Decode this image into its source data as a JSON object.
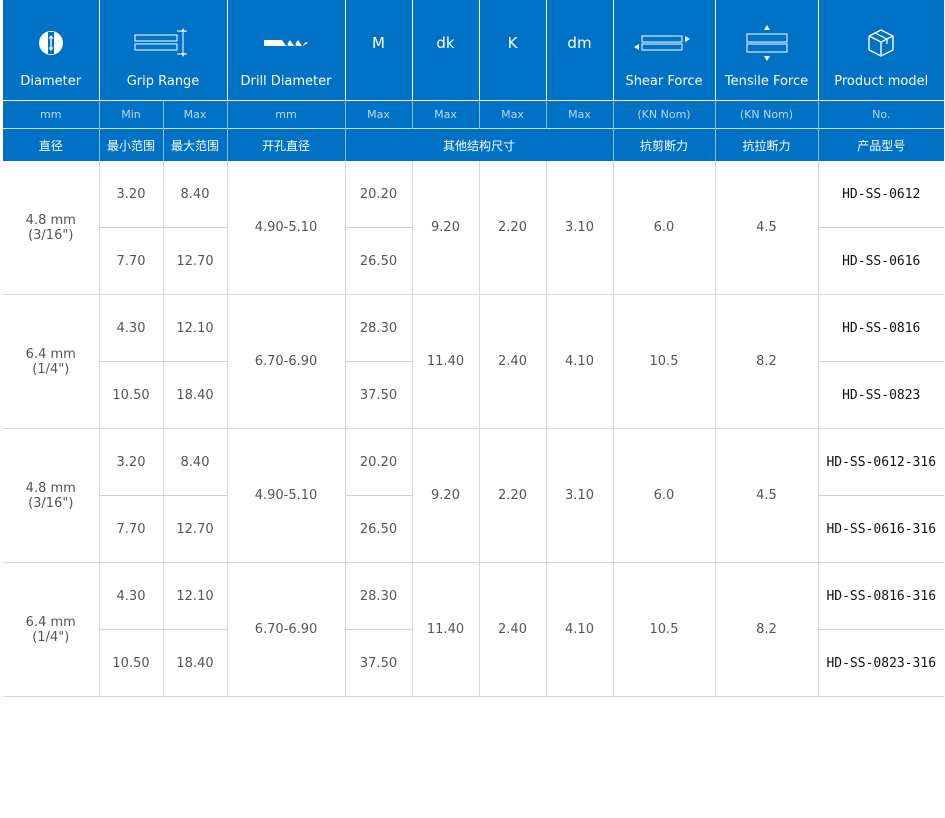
{
  "headers": {
    "diameter": {
      "title": "Diameter",
      "unit": "mm",
      "cn": "直径"
    },
    "grip": {
      "title": "Grip Range",
      "min": "Min",
      "max": "Max",
      "cn_min": "最小范围",
      "cn_max": "最大范围"
    },
    "drill": {
      "title": "Drill Diameter",
      "unit": "mm",
      "cn": "开孔直径"
    },
    "m": {
      "title": "M",
      "unit": "Max"
    },
    "dk": {
      "title": "dk",
      "unit": "Max"
    },
    "k": {
      "title": "K",
      "unit": "Max"
    },
    "dm": {
      "title": "dm",
      "unit": "Max"
    },
    "other_cn": "其他结构尺寸",
    "shear": {
      "title": "Shear Force",
      "unit": "(KN Nom)",
      "cn": "抗剪断力"
    },
    "tensile": {
      "title": "Tensile Force",
      "unit": "(KN Nom)",
      "cn": "抗拉断力"
    },
    "model": {
      "title": "Product model",
      "unit": "No.",
      "cn": "产品型号"
    }
  },
  "groups": [
    {
      "dia": "4.8 mm",
      "dia_in": "(3/16\")",
      "drill": "4.90-5.10",
      "dk": "9.20",
      "k": "2.20",
      "dm": "3.10",
      "shear": "6.0",
      "tensile": "4.5",
      "rows": [
        {
          "min": "3.20",
          "max": "8.40",
          "m": "20.20",
          "model_prefix": "HD-SS",
          "model_suffix": "-0612"
        },
        {
          "min": "7.70",
          "max": "12.70",
          "m": "26.50",
          "model_prefix": "HD-SS",
          "model_suffix": "-0616"
        }
      ]
    },
    {
      "dia": "6.4 mm",
      "dia_in": "(1/4\")",
      "drill": "6.70-6.90",
      "dk": "11.40",
      "k": "2.40",
      "dm": "4.10",
      "shear": "10.5",
      "tensile": "8.2",
      "rows": [
        {
          "min": "4.30",
          "max": "12.10",
          "m": "28.30",
          "model_prefix": "HD-SS",
          "model_suffix": "-0816"
        },
        {
          "min": "10.50",
          "max": "18.40",
          "m": "37.50",
          "model_prefix": "HD-SS",
          "model_suffix": "-0823"
        }
      ]
    },
    {
      "dia": "4.8 mm",
      "dia_in": "(3/16\")",
      "drill": "4.90-5.10",
      "dk": "9.20",
      "k": "2.20",
      "dm": "3.10",
      "shear": "6.0",
      "tensile": "4.5",
      "rows": [
        {
          "min": "3.20",
          "max": "8.40",
          "m": "20.20",
          "model_prefix": "HD-SS",
          "model_suffix": "-0612-316"
        },
        {
          "min": "7.70",
          "max": "12.70",
          "m": "26.50",
          "model_prefix": "HD-SS",
          "model_suffix": "-0616-316"
        }
      ]
    },
    {
      "dia": "6.4 mm",
      "dia_in": "(1/4\")",
      "drill": "6.70-6.90",
      "dk": "11.40",
      "k": "2.40",
      "dm": "4.10",
      "shear": "10.5",
      "tensile": "8.2",
      "rows": [
        {
          "min": "4.30",
          "max": "12.10",
          "m": "28.30",
          "model_prefix": "HD-SS",
          "model_suffix": "-0816-316"
        },
        {
          "min": "10.50",
          "max": "18.40",
          "m": "37.50",
          "model_prefix": "HD-SS",
          "model_suffix": "-0823-316"
        }
      ]
    }
  ],
  "colors": {
    "header_bg": "#0072c6",
    "header_text": "#ffffff",
    "body_text": "#555555",
    "grid": "#d7d7d7"
  },
  "icons": [
    "rivet-diameter-icon",
    "grip-range-icon",
    "drill-bit-icon",
    "shear-force-icon",
    "tensile-force-icon",
    "product-box-icon"
  ]
}
